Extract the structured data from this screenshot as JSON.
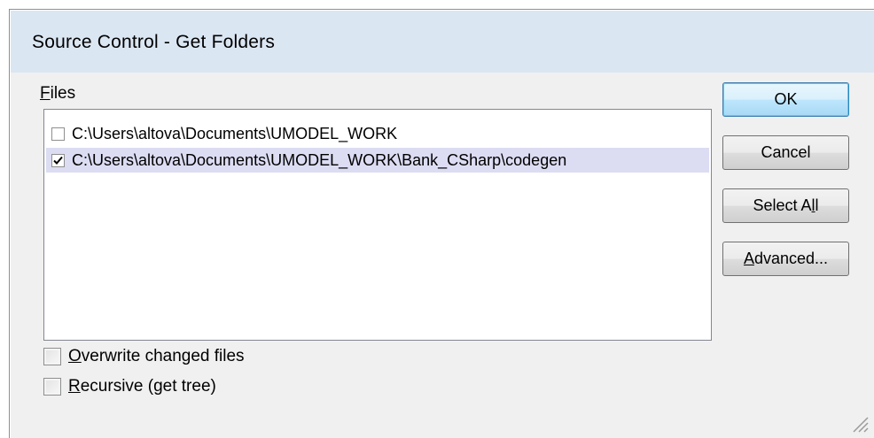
{
  "dialog": {
    "title": "Source Control - Get Folders",
    "files_label_mnemonic": "F",
    "files_label_rest": "iles",
    "files": [
      {
        "path": "C:\\Users\\altova\\Documents\\UMODEL_WORK",
        "checked": false,
        "selected": false
      },
      {
        "path": "C:\\Users\\altova\\Documents\\UMODEL_WORK\\Bank_CSharp\\codegen",
        "checked": true,
        "selected": true
      }
    ],
    "buttons": {
      "ok": "OK",
      "cancel": "Cancel",
      "select_all_pre": "Select A",
      "select_all_mnemonic": "l",
      "select_all_post": "l",
      "advanced_mnemonic": "A",
      "advanced_rest": "dvanced..."
    },
    "options": {
      "overwrite_mnemonic": "O",
      "overwrite_rest": "verwrite changed files",
      "overwrite_checked": false,
      "recursive_mnemonic": "R",
      "recursive_rest": "ecursive (get tree)",
      "recursive_checked": false
    }
  },
  "colors": {
    "titlebar": "#dbe6f3",
    "dialog_bg": "#f0f0f0",
    "selected_row": "#dcdcf3",
    "default_button_border": "#3c7fb1"
  },
  "icons": [
    "checkmark-icon",
    "resize-grip-icon"
  ]
}
